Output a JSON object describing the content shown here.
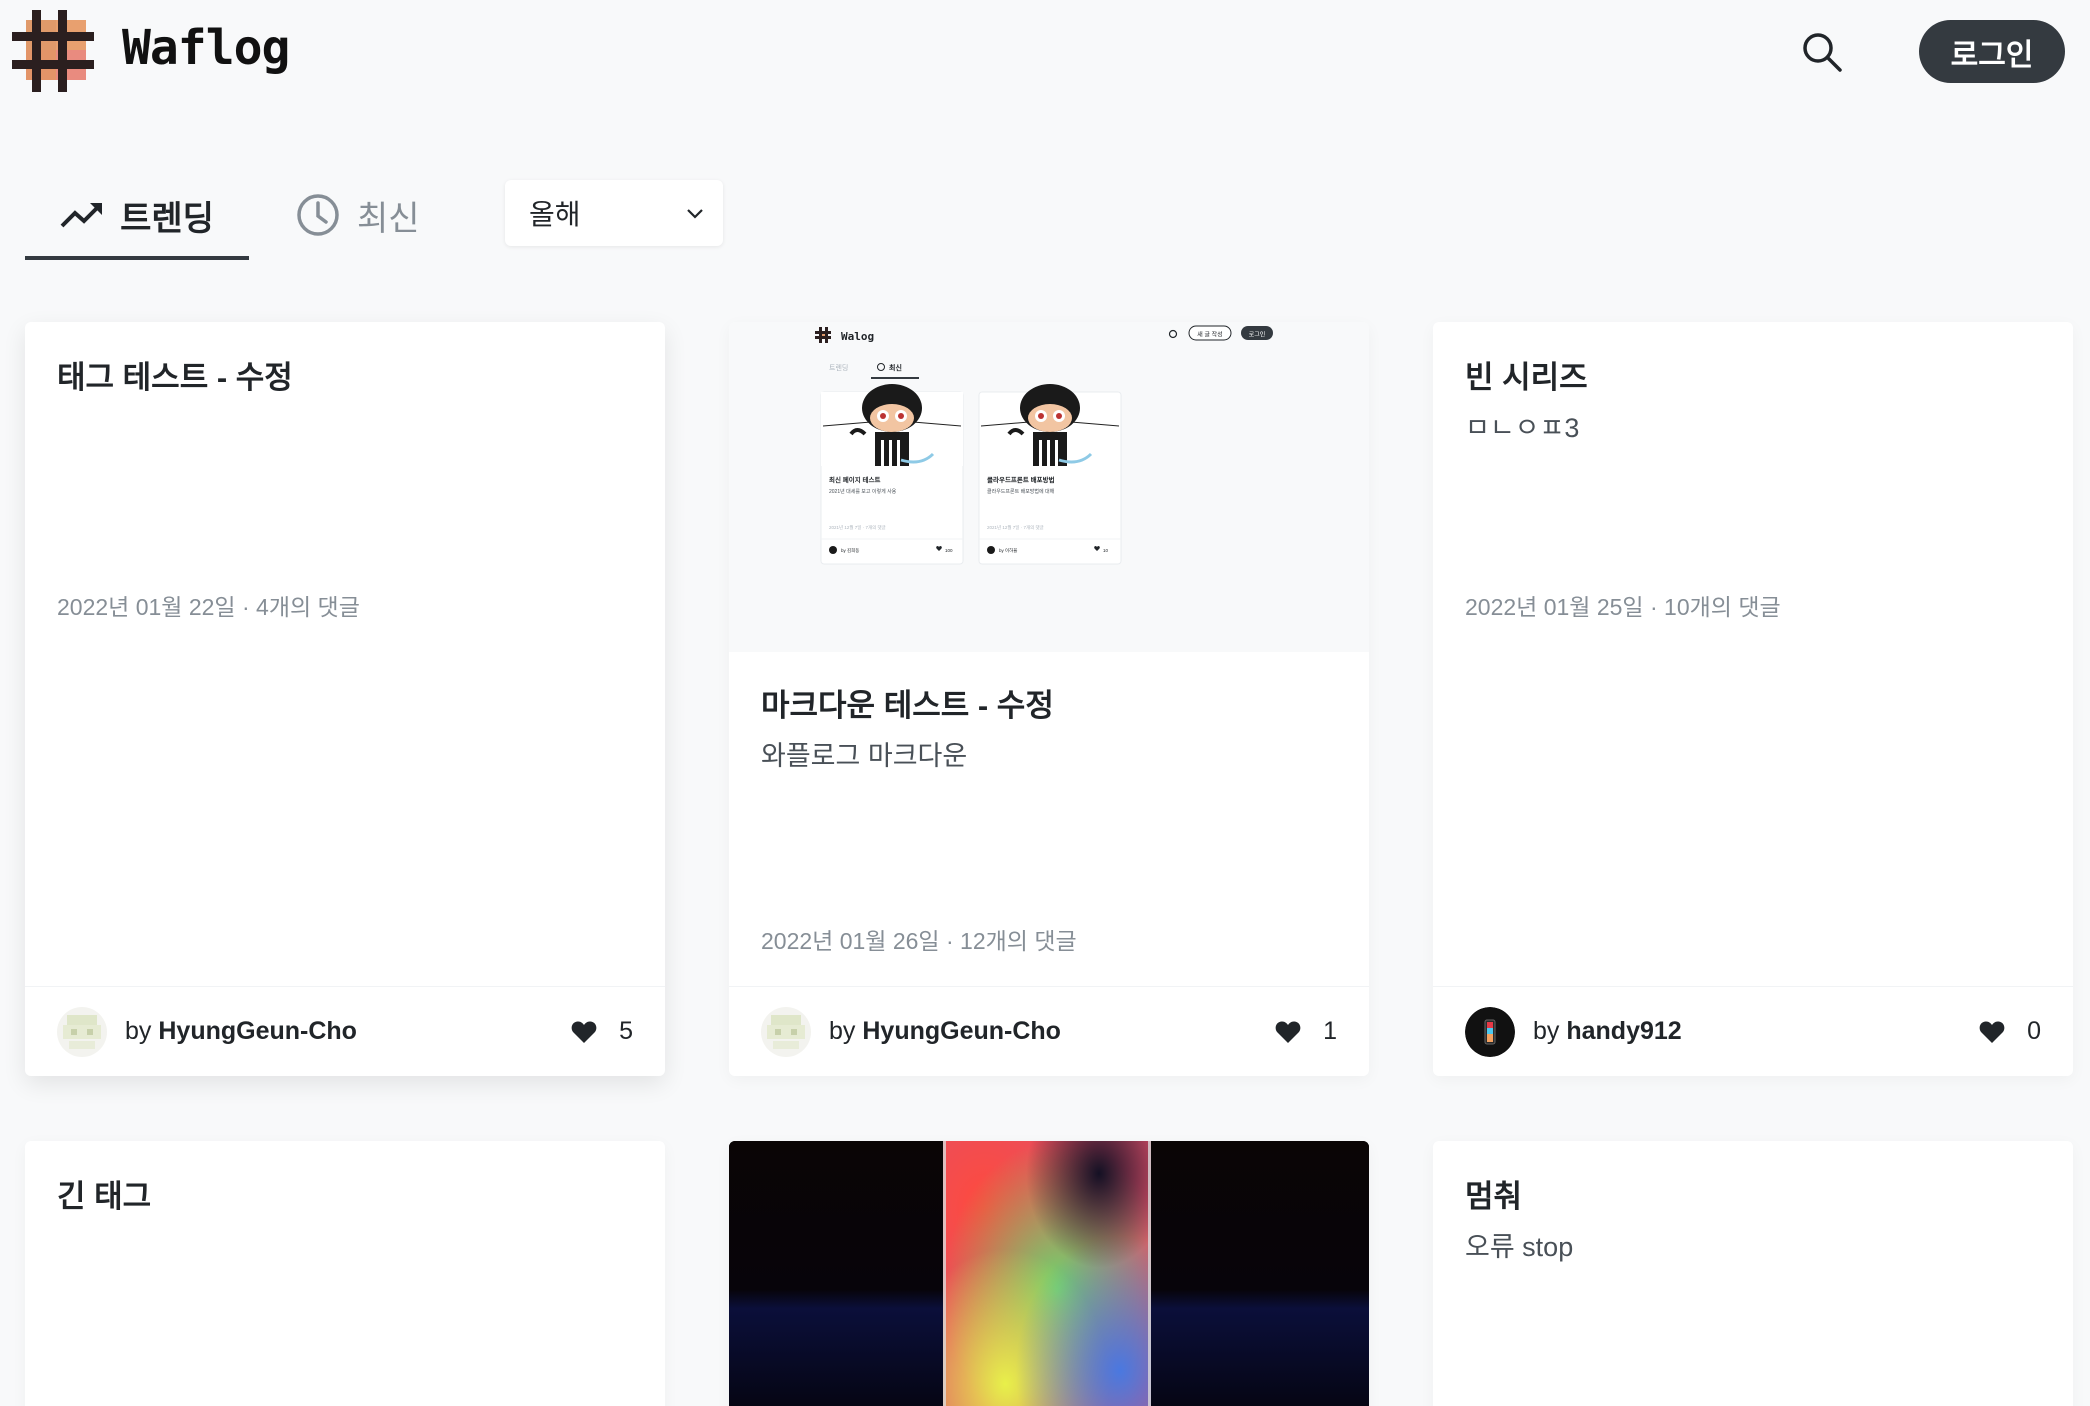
{
  "header": {
    "logo_text": "Waflog",
    "login_label": "로그인"
  },
  "tabs": {
    "trending_label": "트렌딩",
    "recent_label": "최신",
    "period_selected": "올해"
  },
  "cards": [
    {
      "title": "태그 테스트 - 수정",
      "description": "",
      "meta": "2022년 01월 22일 · 4개의 댓글",
      "by": "by",
      "author": "HyungGeun-Cho",
      "likes": "5"
    },
    {
      "title": "마크다운 테스트 - 수정",
      "description": "와플로그 마크다운",
      "meta": "2022년 01월 26일 · 12개의 댓글",
      "by": "by",
      "author": "HyungGeun-Cho",
      "likes": "1",
      "thumbnail": {
        "logo": "Walog",
        "buttons": [
          "새 글 작성",
          "로그인"
        ],
        "tabs": [
          "트렌딩",
          "최신"
        ],
        "mini_cards": [
          {
            "title": "최신 페이지 테스트",
            "desc": "2021년 대세를 보고 이렇게 사용",
            "date": "2021년 12월 7일 · 7개의 댓글",
            "author": "by 김희동",
            "likes": "100"
          },
          {
            "title": "클라우드프론트 배포방법",
            "desc": "클라우드프론트 배포방법에 대해",
            "date": "2021년 12월 7일 · 7개의 댓글",
            "author": "by 이하율",
            "likes": "10"
          }
        ]
      }
    },
    {
      "title": "빈 시리즈",
      "description": "ㅁㄴㅇㅍ3",
      "meta": "2022년 01월 25일 · 10개의 댓글",
      "by": "by",
      "author": "handy912",
      "likes": "0"
    },
    {
      "title": "긴 태그",
      "description": ""
    },
    {
      "title": "",
      "description": ""
    },
    {
      "title": "멈춰",
      "description": "오류 stop"
    }
  ],
  "colors": {
    "background": "#f8f9fa",
    "login_button": "#343a40",
    "logo_brown": "#e09a6a",
    "logo_pink": "#e98b7f",
    "logo_dark": "#2b1f1f"
  }
}
